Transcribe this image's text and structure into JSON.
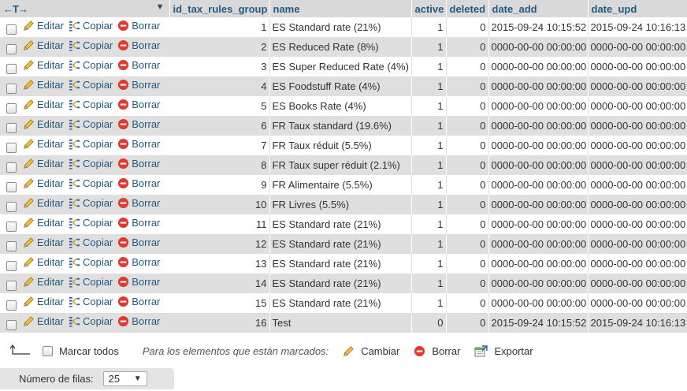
{
  "columns": [
    "id_tax_rules_group",
    "name",
    "active",
    "deleted",
    "date_add",
    "date_upd"
  ],
  "action_labels": {
    "edit": "Editar",
    "copy": "Copiar",
    "delete": "Borrar"
  },
  "rows": [
    {
      "id": "1",
      "name": "ES Standard rate (21%)",
      "active": "1",
      "deleted": "0",
      "date_add": "2015-09-24 10:15:52",
      "date_upd": "2015-09-24 10:16:13"
    },
    {
      "id": "2",
      "name": "ES Reduced Rate (8%)",
      "active": "1",
      "deleted": "0",
      "date_add": "0000-00-00 00:00:00",
      "date_upd": "0000-00-00 00:00:00"
    },
    {
      "id": "3",
      "name": "ES Super Reduced Rate (4%)",
      "active": "1",
      "deleted": "0",
      "date_add": "0000-00-00 00:00:00",
      "date_upd": "0000-00-00 00:00:00"
    },
    {
      "id": "4",
      "name": "ES Foodstuff Rate (4%)",
      "active": "1",
      "deleted": "0",
      "date_add": "0000-00-00 00:00:00",
      "date_upd": "0000-00-00 00:00:00"
    },
    {
      "id": "5",
      "name": "ES Books Rate (4%)",
      "active": "1",
      "deleted": "0",
      "date_add": "0000-00-00 00:00:00",
      "date_upd": "0000-00-00 00:00:00"
    },
    {
      "id": "6",
      "name": "FR Taux standard (19.6%)",
      "active": "1",
      "deleted": "0",
      "date_add": "0000-00-00 00:00:00",
      "date_upd": "0000-00-00 00:00:00"
    },
    {
      "id": "7",
      "name": "FR Taux réduit (5.5%)",
      "active": "1",
      "deleted": "0",
      "date_add": "0000-00-00 00:00:00",
      "date_upd": "0000-00-00 00:00:00"
    },
    {
      "id": "8",
      "name": "FR Taux super réduit (2.1%)",
      "active": "1",
      "deleted": "0",
      "date_add": "0000-00-00 00:00:00",
      "date_upd": "0000-00-00 00:00:00"
    },
    {
      "id": "9",
      "name": "FR Alimentaire (5.5%)",
      "active": "1",
      "deleted": "0",
      "date_add": "0000-00-00 00:00:00",
      "date_upd": "0000-00-00 00:00:00"
    },
    {
      "id": "10",
      "name": "FR Livres (5.5%)",
      "active": "1",
      "deleted": "0",
      "date_add": "0000-00-00 00:00:00",
      "date_upd": "0000-00-00 00:00:00"
    },
    {
      "id": "11",
      "name": "ES Standard rate (21%)",
      "active": "1",
      "deleted": "0",
      "date_add": "0000-00-00 00:00:00",
      "date_upd": "0000-00-00 00:00:00"
    },
    {
      "id": "12",
      "name": "ES Standard rate (21%)",
      "active": "1",
      "deleted": "0",
      "date_add": "0000-00-00 00:00:00",
      "date_upd": "0000-00-00 00:00:00"
    },
    {
      "id": "13",
      "name": "ES Standard rate (21%)",
      "active": "1",
      "deleted": "0",
      "date_add": "0000-00-00 00:00:00",
      "date_upd": "0000-00-00 00:00:00"
    },
    {
      "id": "14",
      "name": "ES Standard rate (21%)",
      "active": "1",
      "deleted": "0",
      "date_add": "0000-00-00 00:00:00",
      "date_upd": "0000-00-00 00:00:00"
    },
    {
      "id": "15",
      "name": "ES Standard rate (21%)",
      "active": "1",
      "deleted": "0",
      "date_add": "0000-00-00 00:00:00",
      "date_upd": "0000-00-00 00:00:00"
    },
    {
      "id": "16",
      "name": "Test",
      "active": "0",
      "deleted": "0",
      "date_add": "2015-09-24 10:15:52",
      "date_upd": "2015-09-24 10:16:13"
    }
  ],
  "footer": {
    "check_all": "Marcar todos",
    "with_selected": "Para los elementos que están marcados:",
    "change": "Cambiar",
    "delete": "Borrar",
    "export": "Exportar"
  },
  "pagination": {
    "rows_label": "Número de filas:",
    "rows_value": "25"
  },
  "colors": {
    "link": "#235a81",
    "header_bg": "#d9d9d9",
    "row_alt_bg": "#dfdfdf",
    "delete_red": "#e03b2e"
  }
}
